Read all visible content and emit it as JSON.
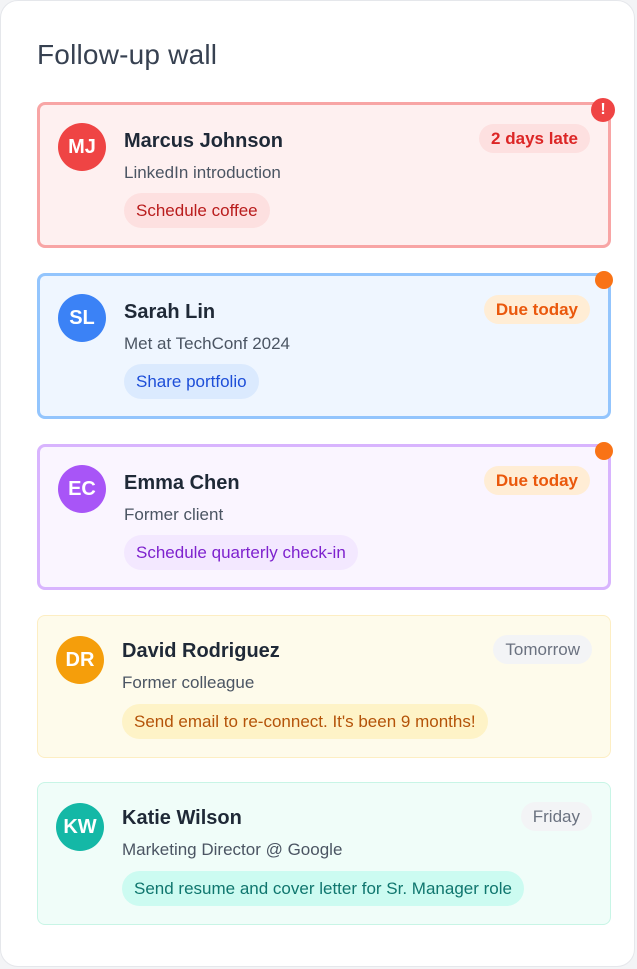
{
  "page": {
    "title": "Follow-up wall"
  },
  "contacts": [
    {
      "initials": "MJ",
      "name": "Marcus Johnson",
      "context": "LinkedIn introduction",
      "action": "Schedule coffee",
      "status": "2 days late",
      "indicator": "!",
      "colors": {
        "card_bg": "#fef0f0",
        "card_border": "#f8a5a5",
        "avatar": "#ef4444",
        "task_bg": "#fde0e0",
        "task_text": "#b91c1c",
        "status_bg": "#fde0e0",
        "status_text": "#dc2626"
      }
    },
    {
      "initials": "SL",
      "name": "Sarah Lin",
      "context": "Met at TechConf 2024",
      "action": "Share portfolio",
      "status": "Due today",
      "colors": {
        "card_bg": "#eff6ff",
        "card_border": "#93c5fd",
        "avatar": "#3b82f6",
        "task_bg": "#dbeafe",
        "task_text": "#1d4ed8",
        "status_bg": "#ffedd5",
        "status_text": "#ea580c",
        "dot": "#f97316"
      }
    },
    {
      "initials": "EC",
      "name": "Emma Chen",
      "context": "Former client",
      "action": "Schedule quarterly check-in",
      "status": "Due today",
      "colors": {
        "card_bg": "#faf5ff",
        "card_border": "#d8b4fe",
        "avatar": "#a855f7",
        "task_bg": "#f3e8ff",
        "task_text": "#7e22ce",
        "status_bg": "#ffedd5",
        "status_text": "#ea580c",
        "dot": "#f97316"
      }
    },
    {
      "initials": "DR",
      "name": "David Rodriguez",
      "context": "Former colleague",
      "action": "Send email to re-connect. It's been 9 months!",
      "status": "Tomorrow",
      "colors": {
        "card_bg": "#fefbeb",
        "card_border": "#fdeec3",
        "avatar": "#f59e0b",
        "task_bg": "#fef3c7",
        "task_text": "#b45309",
        "status_bg": "#f3f4f6",
        "status_text": "#6b7280"
      }
    },
    {
      "initials": "KW",
      "name": "Katie Wilson",
      "context": "Marketing Director @ Google",
      "action": "Send resume and cover letter for Sr. Manager role",
      "status": "Friday",
      "colors": {
        "card_bg": "#f0fdf9",
        "card_border": "#c8f5e6",
        "avatar": "#14b8a6",
        "task_bg": "#ccfbf1",
        "task_text": "#0f766e",
        "status_bg": "#f3f4f6",
        "status_text": "#6b7280"
      }
    }
  ]
}
